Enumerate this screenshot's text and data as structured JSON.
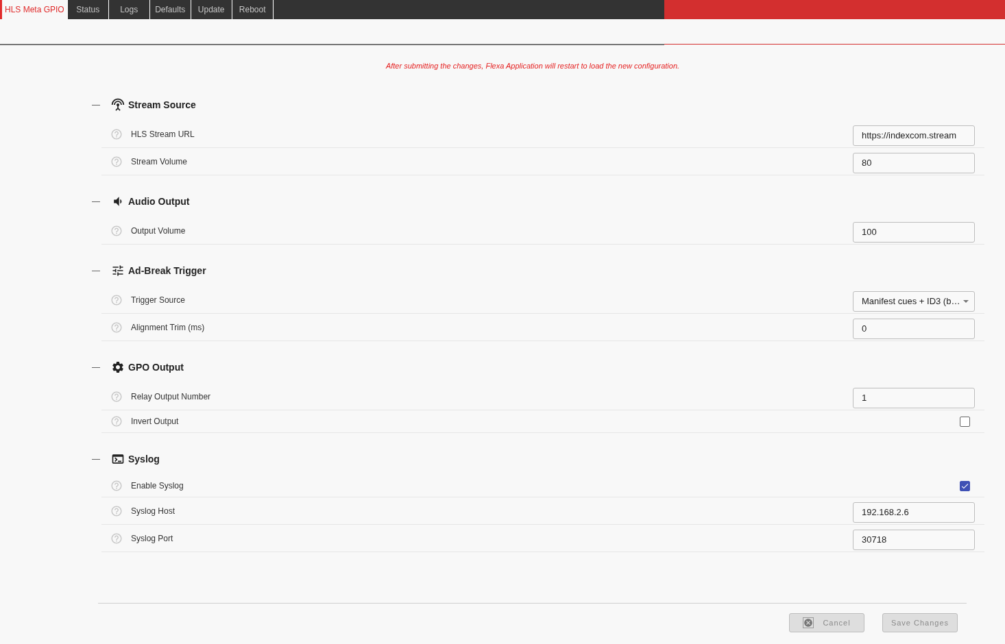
{
  "nav": {
    "tabs": [
      {
        "label": "HLS Meta GPIO",
        "selected": true
      },
      {
        "label": "Status",
        "selected": false
      },
      {
        "label": "Logs",
        "selected": false
      },
      {
        "label": "Defaults",
        "selected": false
      },
      {
        "label": "Update",
        "selected": false
      },
      {
        "label": "Reboot",
        "selected": false
      }
    ]
  },
  "notice": "After submitting the changes, Flexa Application will restart to load the new configuration.",
  "sections": [
    {
      "title": "Stream Source",
      "expanded": true,
      "fields": [
        {
          "kind": "text",
          "label": "HLS Stream URL",
          "value": "https://indexcom.stream"
        },
        {
          "kind": "text",
          "label": "Stream Volume",
          "value": "80"
        }
      ]
    },
    {
      "title": "Audio Output",
      "expanded": true,
      "fields": [
        {
          "kind": "text",
          "label": "Output Volume",
          "value": "100"
        }
      ]
    },
    {
      "title": "Ad-Break Trigger",
      "expanded": true,
      "fields": [
        {
          "kind": "select",
          "label": "Trigger Source",
          "value": "Manifest cues + ID3 (b…"
        },
        {
          "kind": "text",
          "label": "Alignment Trim (ms)",
          "value": "0"
        }
      ]
    },
    {
      "title": "GPO Output",
      "expanded": true,
      "fields": [
        {
          "kind": "text",
          "label": "Relay Output Number",
          "value": "1"
        },
        {
          "kind": "checkbox",
          "label": "Invert Output",
          "checked": false
        }
      ]
    },
    {
      "title": "Syslog",
      "expanded": true,
      "fields": [
        {
          "kind": "checkbox",
          "label": "Enable Syslog",
          "checked": true
        },
        {
          "kind": "text",
          "label": "Syslog Host",
          "value": "192.168.2.6"
        },
        {
          "kind": "text",
          "label": "Syslog Port",
          "value": "30718"
        }
      ]
    }
  ],
  "footer": {
    "buttons": [
      {
        "kind": "cancel",
        "label": "Cancel",
        "disabled": true
      },
      {
        "kind": "save",
        "label": "Save Changes",
        "disabled": true
      }
    ]
  }
}
